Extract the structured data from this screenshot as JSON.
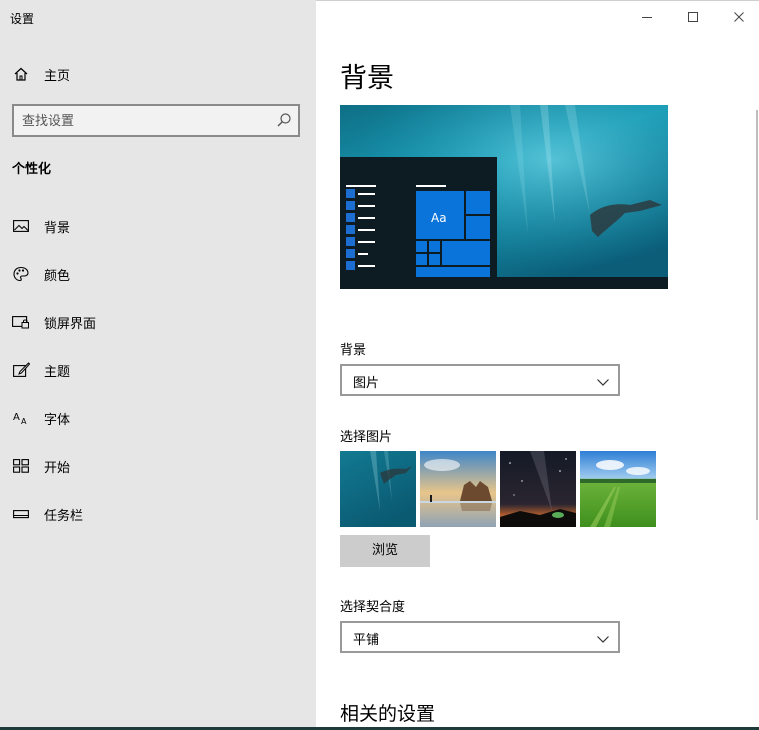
{
  "window": {
    "title": "设置"
  },
  "sidebar": {
    "home_label": "主页",
    "search_placeholder": "查找设置",
    "section_title": "个性化",
    "items": [
      {
        "label": "背景",
        "icon": "picture-icon"
      },
      {
        "label": "颜色",
        "icon": "palette-icon"
      },
      {
        "label": "锁屏界面",
        "icon": "lock-screen-icon"
      },
      {
        "label": "主题",
        "icon": "theme-brush-icon"
      },
      {
        "label": "字体",
        "icon": "font-icon"
      },
      {
        "label": "开始",
        "icon": "start-grid-icon"
      },
      {
        "label": "任务栏",
        "icon": "taskbar-icon"
      }
    ]
  },
  "main": {
    "page_title": "背景",
    "preview_tile_text": "Aa",
    "background_label": "背景",
    "background_value": "图片",
    "choose_picture_label": "选择图片",
    "browse_label": "浏览",
    "fit_label": "选择契合度",
    "fit_value": "平铺",
    "related_title": "相关的设置"
  },
  "colors": {
    "sidebar_bg": "#e6e6e6",
    "accent": "#0a74da",
    "browse_bg": "#cccccc"
  }
}
